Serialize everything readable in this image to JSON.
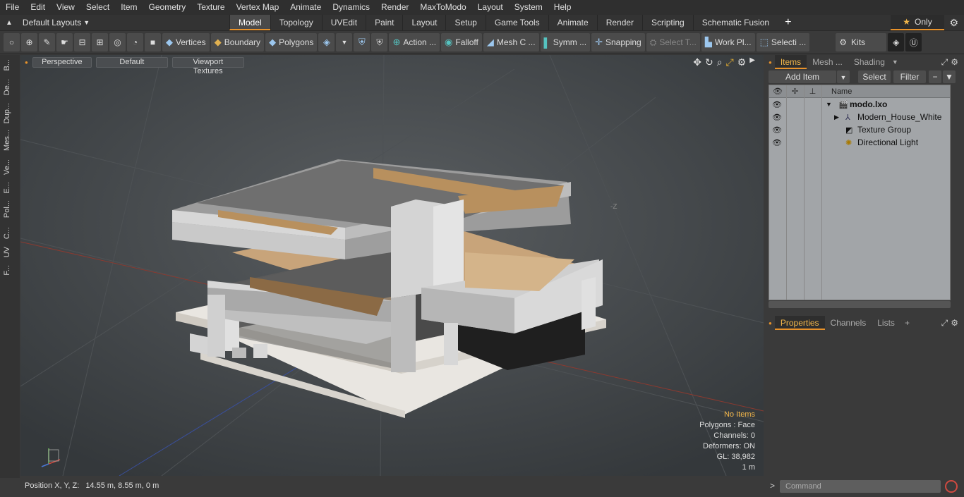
{
  "menu": [
    "File",
    "Edit",
    "View",
    "Select",
    "Item",
    "Geometry",
    "Texture",
    "Vertex Map",
    "Animate",
    "Dynamics",
    "Render",
    "MaxToModo",
    "Layout",
    "System",
    "Help"
  ],
  "layout_selector": "Default Layouts",
  "tabs": [
    {
      "label": "Model",
      "active": true
    },
    {
      "label": "Topology"
    },
    {
      "label": "UVEdit"
    },
    {
      "label": "Paint"
    },
    {
      "label": "Layout"
    },
    {
      "label": "Setup"
    },
    {
      "label": "Game Tools"
    },
    {
      "label": "Animate"
    },
    {
      "label": "Render"
    },
    {
      "label": "Scripting"
    },
    {
      "label": "Schematic Fusion"
    }
  ],
  "only_label": "Only",
  "toolbar": {
    "vertices": "Vertices",
    "boundary": "Boundary",
    "polygons": "Polygons",
    "action": "Action ...",
    "falloff": "Falloff",
    "mesh": "Mesh C ...",
    "symm": "Symm ...",
    "snapping": "Snapping",
    "select_t": "Select T...",
    "work_pl": "Work Pl...",
    "selecti": "Selecti ...",
    "kits": "Kits"
  },
  "left_tabs": [
    "B...",
    "De...",
    "Dup...",
    "Mes...",
    "Ve...",
    "E...",
    "Pol...",
    "C...",
    "UV",
    "F..."
  ],
  "viewport": {
    "view": "Perspective",
    "shading": "Default",
    "textures": "Viewport Textures",
    "axis_label": "-Z",
    "info": {
      "no_items": "No Items",
      "polygons": "Polygons : Face",
      "channels": "Channels: 0",
      "deformers": "Deformers: ON",
      "gl": "GL: 38,982",
      "scale": "1 m"
    }
  },
  "status": {
    "label": "Position X, Y, Z:",
    "value": "14.55 m, 8.55 m, 0 m"
  },
  "items_panel": {
    "tabs": [
      "Items",
      "Mesh ...",
      "Shading"
    ],
    "add_item": "Add Item",
    "select": "Select",
    "filter": "Filter",
    "col_name": "Name",
    "rows": [
      {
        "label": "modo.lxo",
        "bold": true
      },
      {
        "label": "Modern_House_White"
      },
      {
        "label": "Texture Group"
      },
      {
        "label": "Directional Light"
      }
    ]
  },
  "props_panel": {
    "tabs": [
      "Properties",
      "Channels",
      "Lists"
    ]
  },
  "command": {
    "placeholder": "Command"
  }
}
